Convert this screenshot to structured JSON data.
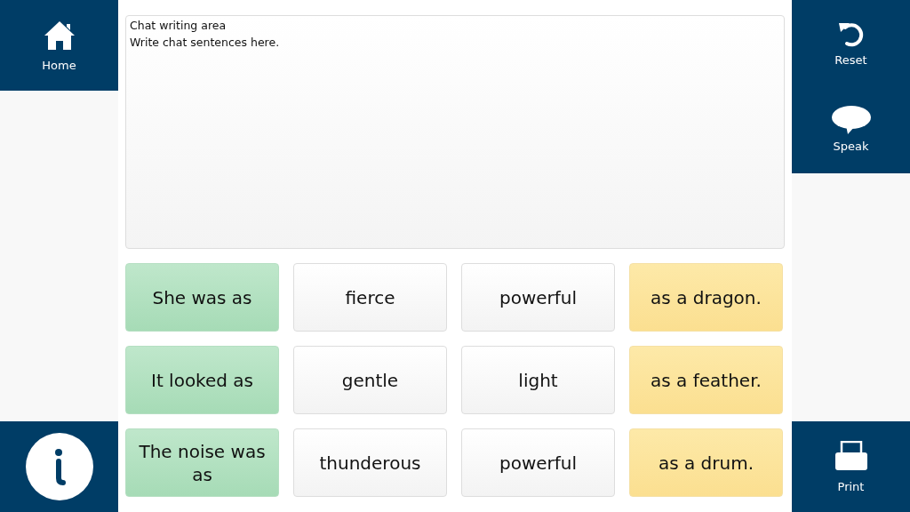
{
  "left_nav": {
    "home": {
      "label": "Home"
    }
  },
  "right_nav": [
    {
      "kind": "reset",
      "label": "Reset"
    },
    {
      "kind": "speak",
      "label": "Speak"
    }
  ],
  "chat_area": {
    "label": "Chat writing area",
    "placeholder": "Write chat sentences here."
  },
  "tiles": [
    [
      {
        "kind": "start",
        "text": "She was as"
      },
      {
        "kind": "word",
        "text": "fierce"
      },
      {
        "kind": "word",
        "text": "powerful"
      },
      {
        "kind": "end",
        "text": "as a dragon."
      }
    ],
    [
      {
        "kind": "start",
        "text": "It looked as"
      },
      {
        "kind": "word",
        "text": "gentle"
      },
      {
        "kind": "word",
        "text": "light"
      },
      {
        "kind": "end",
        "text": "as a feather."
      }
    ],
    [
      {
        "kind": "start",
        "text": "The noise was as"
      },
      {
        "kind": "word",
        "text": "thunderous"
      },
      {
        "kind": "word",
        "text": "powerful"
      },
      {
        "kind": "end",
        "text": "as a drum."
      }
    ]
  ],
  "print": {
    "label": "Print"
  }
}
